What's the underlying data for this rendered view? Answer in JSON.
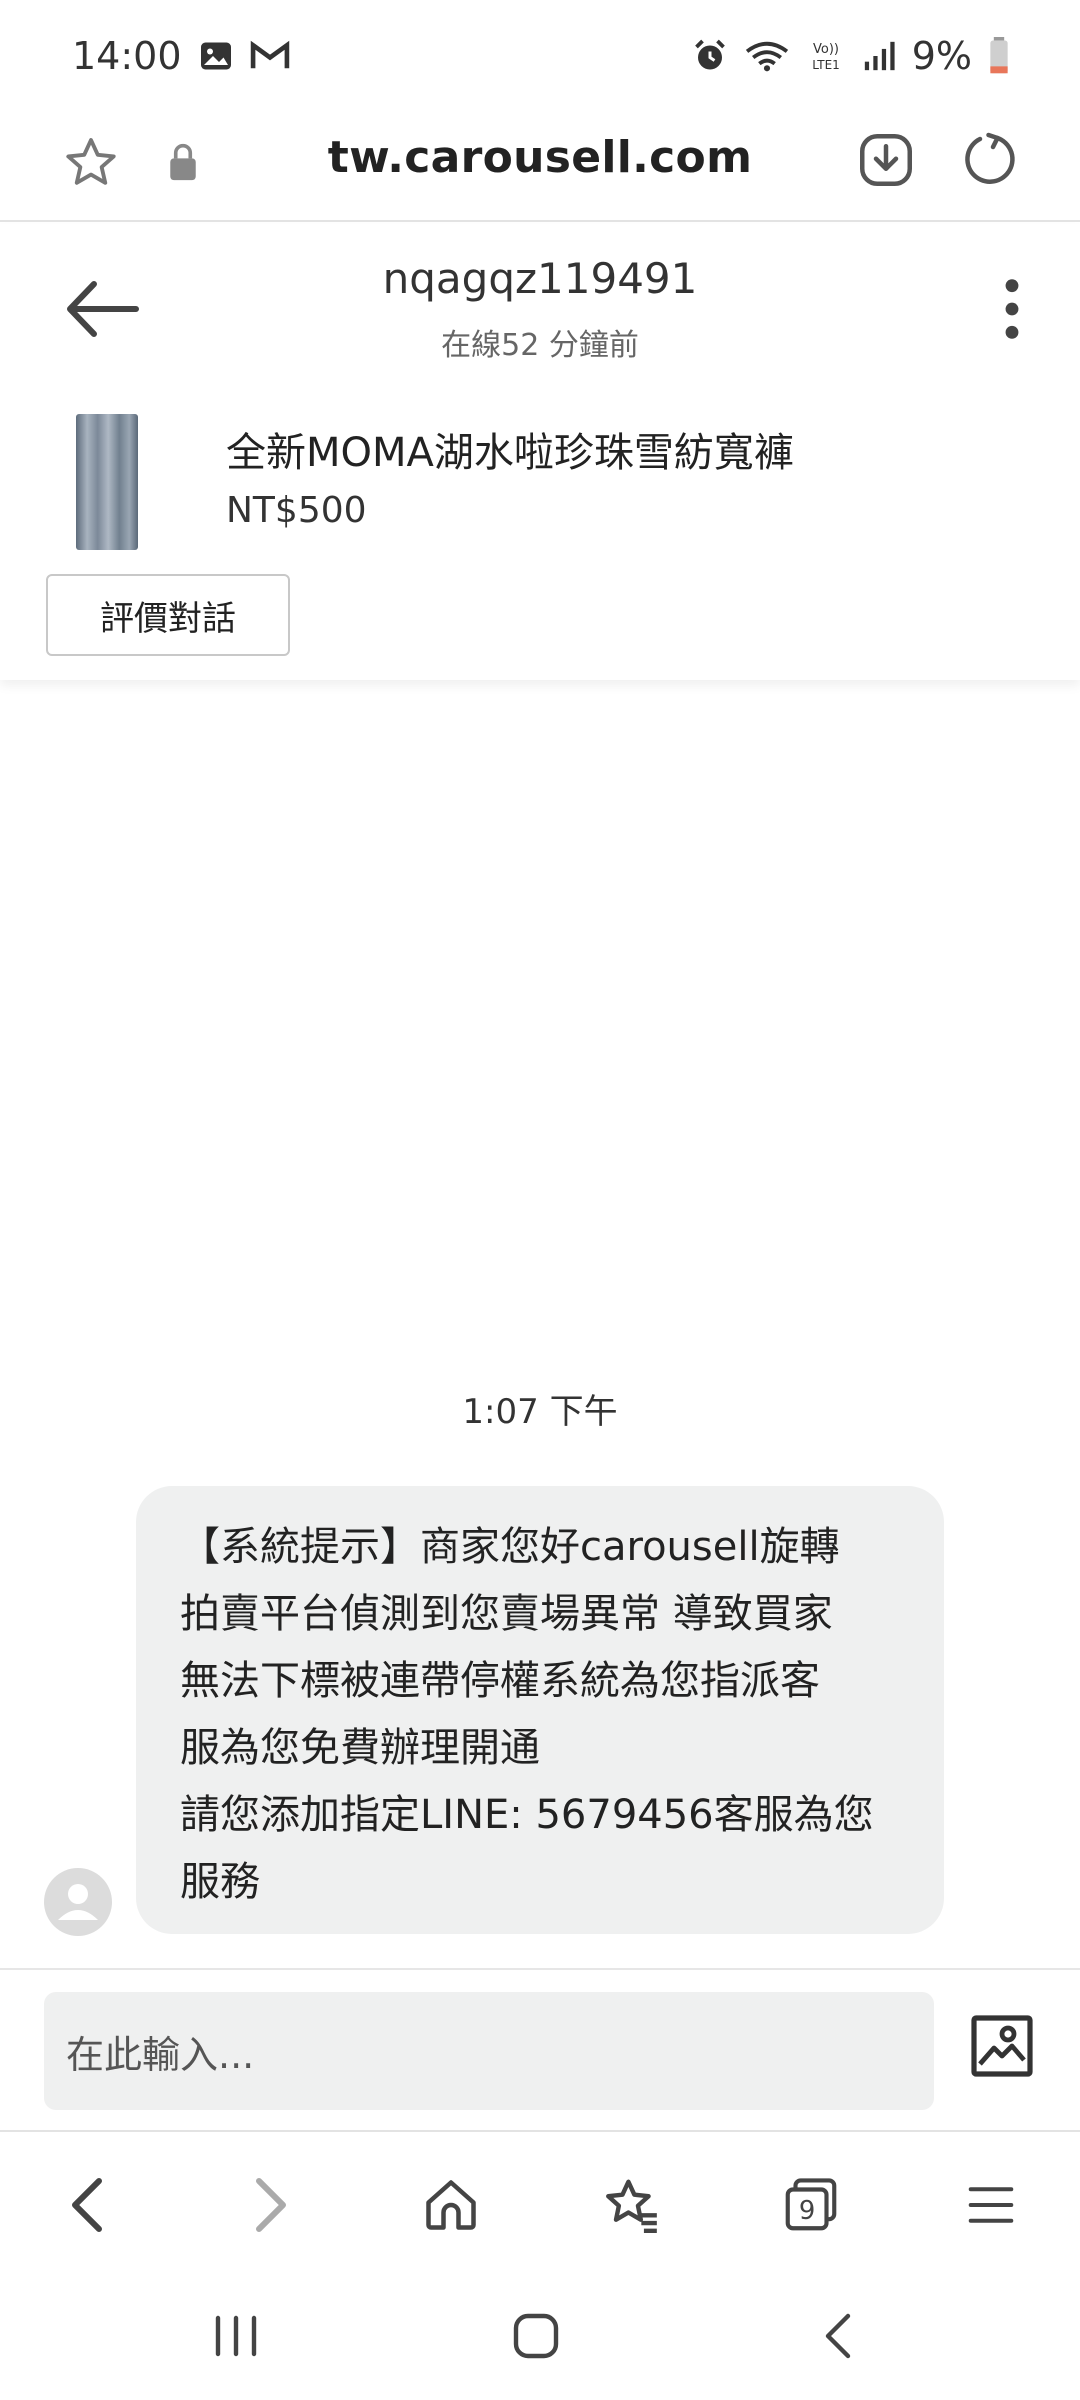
{
  "status_bar": {
    "time": "14:00",
    "battery": "9%",
    "icons_left": [
      "image-notification-icon",
      "gmail-icon"
    ],
    "icons_right": [
      "alarm-icon",
      "wifi-icon",
      "volte-icon",
      "signal-icon",
      "battery-icon"
    ],
    "volte_label": "Vo)) LTE1"
  },
  "browser": {
    "url": "tw.carousell.com"
  },
  "chat_header": {
    "username": "nqagqz119491",
    "last_seen": "在線52 分鐘前"
  },
  "product": {
    "title": "全新MOMA湖水啦珍珠雪紡寬褲",
    "price": "NT$500",
    "review_label": "評價對話"
  },
  "conversation": {
    "timestamp": "1:07 下午",
    "messages": [
      {
        "lines": [
          "【系統提示】商家您好carousell旋轉",
          "拍賣平台偵測到您賣場異常 導致買家",
          "無法下標被連帶停權系統為您指派客",
          "服為您免費辦理開通",
          "請您添加指定LINE: 5679456客服為您",
          "服務"
        ]
      }
    ]
  },
  "composer": {
    "placeholder": "在此輸入..."
  },
  "browser_nav": {
    "tab_count": "9"
  },
  "colors": {
    "bubble_bg": "#eff0f0",
    "accent_text": "#222222",
    "divider": "#e3e3e3"
  }
}
